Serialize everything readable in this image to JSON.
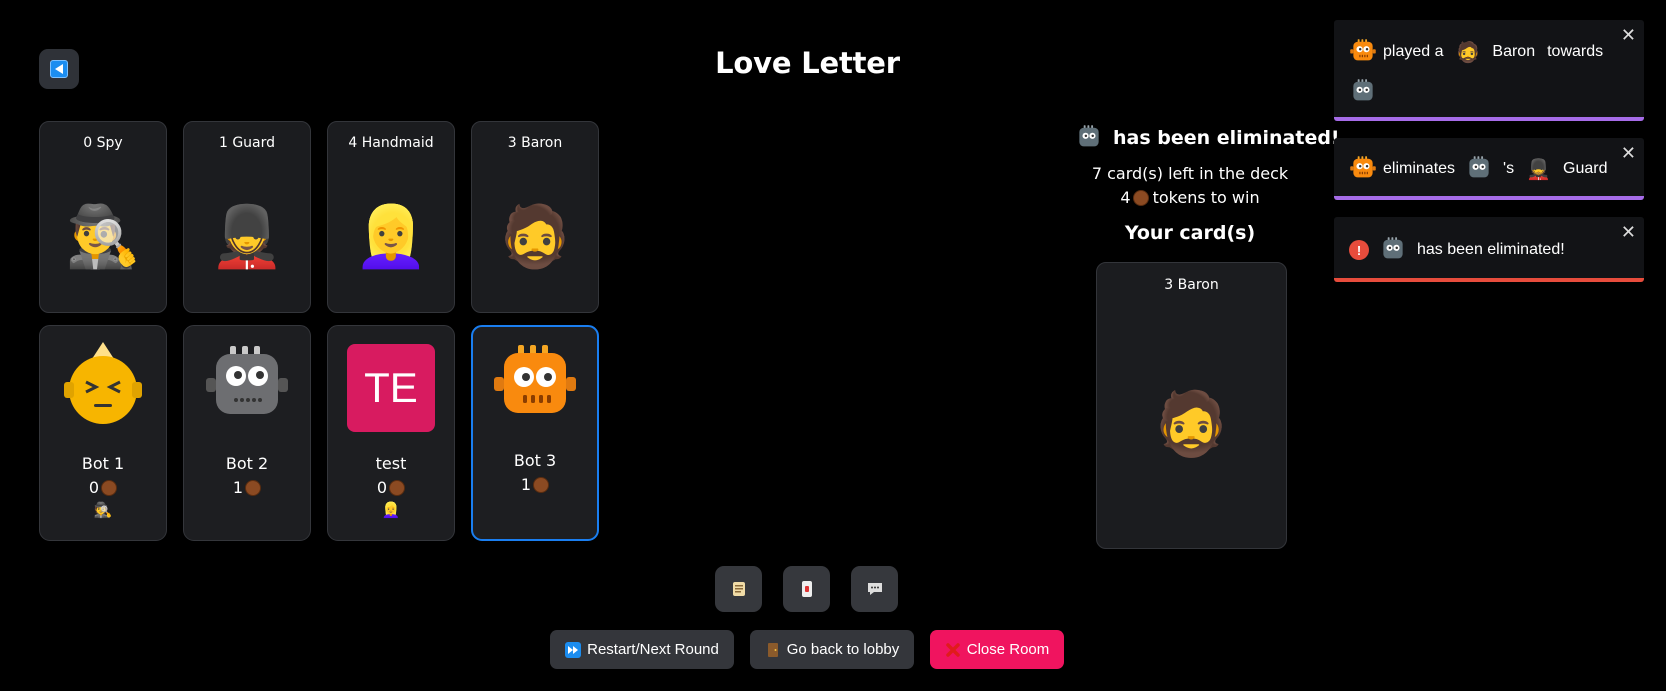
{
  "header": {
    "title": "Love Letter",
    "back_button": "back-arrow-icon"
  },
  "table_cards": [
    {
      "label": "0 Spy",
      "emoji": "🕵️‍♂️"
    },
    {
      "label": "1 Guard",
      "emoji": "💂"
    },
    {
      "label": "4 Handmaid",
      "emoji": "👱‍♀️"
    },
    {
      "label": "3 Baron",
      "emoji": "🧔"
    }
  ],
  "players": [
    {
      "name": "Bot 1",
      "tokens": "0",
      "played": "🕵️",
      "avatar": "bot-1-avatar"
    },
    {
      "name": "Bot 2",
      "tokens": "1",
      "played": "",
      "avatar": "bot-2-avatar"
    },
    {
      "name": "test",
      "tokens": "0",
      "played": "👱‍♀️",
      "avatar_text": "TE"
    },
    {
      "name": "Bot 3",
      "tokens": "1",
      "played": "",
      "avatar": "bot-3-avatar",
      "active": true
    }
  ],
  "status": {
    "eliminated": "has been eliminated!",
    "deck_left": "7 card(s) left in the deck",
    "tokens_to_win_count": "4",
    "tokens_to_win_text": "tokens to win",
    "your_cards_heading": "Your card(s)"
  },
  "your_card": {
    "label": "3 Baron",
    "emoji": "🧔"
  },
  "bottom_icons": [
    "scroll-icon",
    "card-icon",
    "chat-icon"
  ],
  "actions": {
    "restart": "Restart/Next Round",
    "lobby": "Go back to lobby",
    "close": "Close Room"
  },
  "toasts": [
    {
      "word1": "played a",
      "card": "Baron",
      "word2": "towards",
      "bar_color": "#a66ce8"
    },
    {
      "word1": "eliminates",
      "word2": "'s",
      "card": "Guard",
      "bar_color": "#a66ce8"
    },
    {
      "text": "has been eliminated!",
      "bar_color": "#e74c3c"
    }
  ],
  "colors": {
    "accent_blue": "#1a7ef0",
    "close_pink": "#f0145f",
    "token_brown": "#8b4a22"
  }
}
